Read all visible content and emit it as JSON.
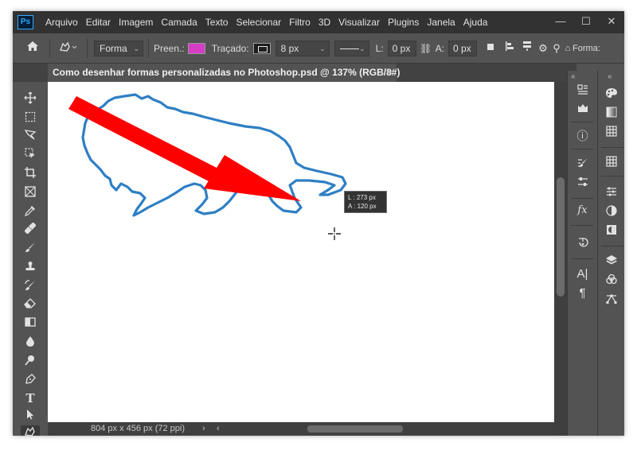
{
  "app": {
    "logo": "Ps"
  },
  "menubar": {
    "items": [
      "Arquivo",
      "Editar",
      "Imagem",
      "Camada",
      "Texto",
      "Selecionar",
      "Filtro",
      "3D",
      "Visualizar",
      "Plugins",
      "Janela",
      "Ajuda"
    ]
  },
  "window_controls": {
    "minimize": "—",
    "maximize": "☐",
    "close": "✕"
  },
  "options": {
    "mode": "Forma",
    "fill_label": "Preen.:",
    "fill_color": "#d63cc4",
    "stroke_label": "Traçado:",
    "stroke_width": "8 px",
    "width_label": "L:",
    "width_value": "0 px",
    "height_label": "A:",
    "height_value": "0 px",
    "shape_label": "Forma:"
  },
  "document": {
    "tab_title": "Como desenhar formas personalizadas no Photoshop.psd @ 137% (RGB/8#)",
    "close": "×",
    "status": "804 px x 456 px (72 ppi)",
    "status_arrow": "›",
    "status_arrow2": "‹"
  },
  "measure": {
    "width_line": "L :  273 px",
    "height_line": "A :  120 px"
  },
  "colors": {
    "shape_outline": "#2e7fc4",
    "arrow": "#ff0000",
    "canvas": "#ffffff",
    "workspace": "#535353"
  },
  "tools": [
    "move-icon",
    "marquee-icon",
    "lasso-icon",
    "object-select-icon",
    "crop-icon",
    "frame-icon",
    "eyedropper-icon",
    "healing-icon",
    "brush-icon",
    "stamp-icon",
    "history-brush-icon",
    "eraser-icon",
    "gradient-icon",
    "blur-icon",
    "dodge-icon",
    "pen-icon",
    "type-icon",
    "path-select-icon",
    "custom-shape-icon"
  ],
  "panels_mid": [
    "history-icon",
    "actions-icon",
    "info-icon",
    "brush-settings-icon",
    "properties-icon",
    "fx-icon",
    "timeline-icon",
    "character-icon",
    "paragraph-icon"
  ],
  "panels_right": [
    "color-icon",
    "swatches-icon",
    "gradients-icon",
    "patterns-icon",
    "adjustments-icon",
    "hue-icon",
    "mask-icon",
    "layers-icon",
    "channels-icon",
    "paths-icon"
  ],
  "labels": {
    "type_tool": "T",
    "fx": "fx",
    "character": "A|",
    "paragraph": "¶",
    "info": "ⓘ"
  }
}
